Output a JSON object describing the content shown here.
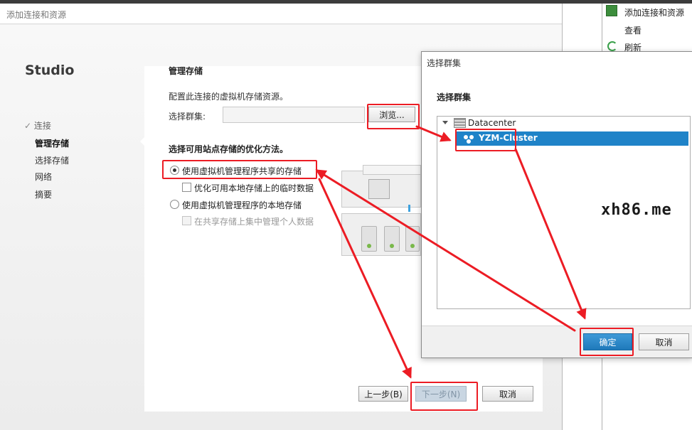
{
  "wizard": {
    "title": "添加连接和资源",
    "brand": "Studio",
    "steps": [
      {
        "label": "连接",
        "state": "done"
      },
      {
        "label": "管理存储",
        "state": "active"
      },
      {
        "label": "选择存储",
        "state": "pending"
      },
      {
        "label": "网络",
        "state": "pending"
      },
      {
        "label": "摘要",
        "state": "pending"
      }
    ],
    "content": {
      "section_title": "管理存储",
      "description": "配置此连接的虚拟机存储资源。",
      "cluster_label": "选择群集:",
      "cluster_value": "",
      "browse_label": "浏览...",
      "method_title": "选择可用站点存储的优化方法。",
      "options": [
        {
          "type": "radio",
          "label": "使用虚拟机管理程序共享的存储",
          "checked": true,
          "disabled": false
        },
        {
          "type": "checkbox",
          "label": "优化可用本地存储上的临时数据",
          "checked": false,
          "disabled": false
        },
        {
          "type": "radio",
          "label": "使用虚拟机管理程序的本地存储",
          "checked": false,
          "disabled": false
        },
        {
          "type": "checkbox",
          "label": "在共享存储上集中管理个人数据",
          "checked": false,
          "disabled": true
        }
      ]
    },
    "buttons": {
      "back": "上一步(B)",
      "next": "下一步(N)",
      "cancel": "取消"
    }
  },
  "right_pane": {
    "items": [
      "添加连接和资源",
      "查看",
      "刷新"
    ]
  },
  "dialog": {
    "title": "选择群集",
    "heading": "选择群集",
    "tree": {
      "root": "Datacenter",
      "child": "YZM-Cluster",
      "child_selected": true
    },
    "ok": "确定",
    "cancel": "取消"
  },
  "watermark": "xh86.me",
  "colors": {
    "selection": "#1f83c8",
    "annotation": "#ec1c24",
    "primary_button": "#2a86c6"
  }
}
